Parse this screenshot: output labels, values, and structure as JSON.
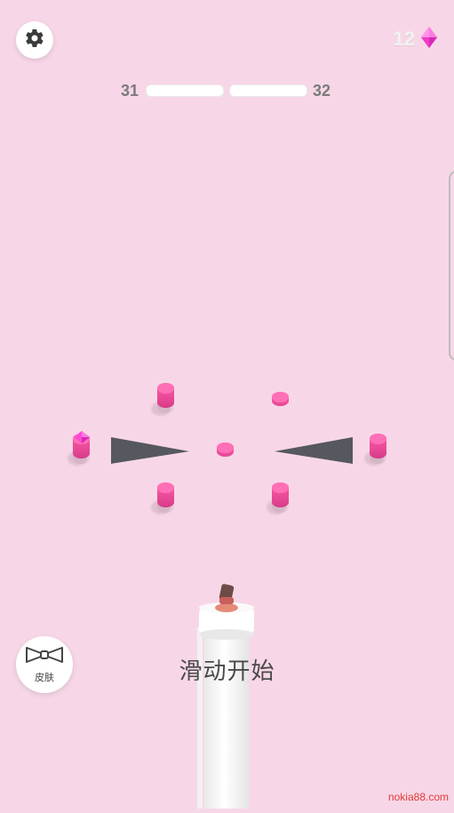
{
  "hud": {
    "gem_count": "12",
    "level_current": "31",
    "level_next": "32",
    "progress_fraction": 0
  },
  "controls": {
    "skins_label": "皮肤",
    "swipe_prompt": "滑动开始"
  },
  "watermark": "nokia88.com",
  "colors": {
    "background": "#f7d7e7",
    "peg": "#ff5aa8",
    "blade": "#55585f",
    "gem": "#ff4ad1"
  },
  "icons": {
    "settings": "gear-icon",
    "gem": "diamond-gem-icon",
    "skins": "bow-tie-icon"
  }
}
